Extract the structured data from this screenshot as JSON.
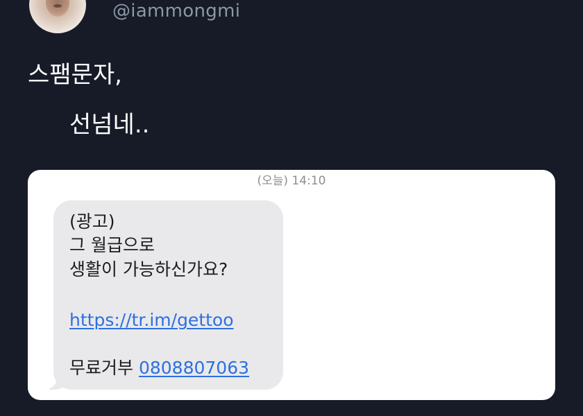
{
  "tweet": {
    "handle": "@iammongmi",
    "text_line1": "스팸문자,",
    "text_line2": "선넘네.."
  },
  "sms": {
    "timestamp": "(오늘) 14:10",
    "bubble_color": "#e9e9eb",
    "link_color": "#2d6fe0",
    "lines": {
      "ad_tag": "(광고)",
      "line2": "그 월급으로",
      "line3": "생활이 가능하신가요?",
      "url": "https://tr.im/gettoo",
      "optout_label": "무료거부",
      "optout_number": "0808807063"
    }
  },
  "colors": {
    "background": "#161b27",
    "handle": "#8b98a5",
    "text": "#ffffff"
  }
}
